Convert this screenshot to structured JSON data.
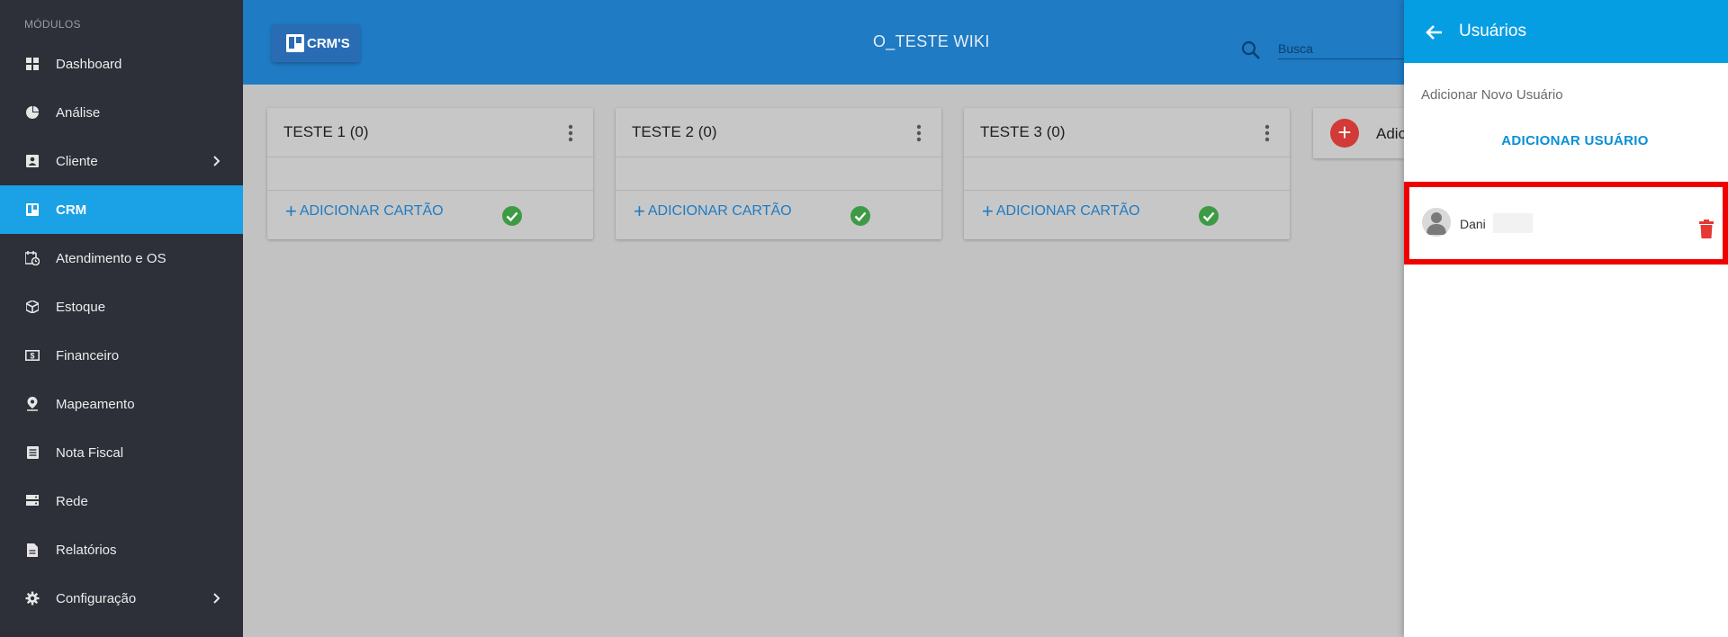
{
  "sidebar": {
    "header": "MÓDULOS",
    "items": [
      {
        "label": "Dashboard",
        "icon": "dashboard-icon"
      },
      {
        "label": "Análise",
        "icon": "pie-chart-icon"
      },
      {
        "label": "Cliente",
        "icon": "contact-icon",
        "expandable": true
      },
      {
        "label": "CRM",
        "icon": "trello-icon",
        "active": true
      },
      {
        "label": "Atendimento e OS",
        "icon": "calendar-clock-icon"
      },
      {
        "label": "Estoque",
        "icon": "box-icon"
      },
      {
        "label": "Financeiro",
        "icon": "money-icon"
      },
      {
        "label": "Mapeamento",
        "icon": "map-pin-icon"
      },
      {
        "label": "Nota Fiscal",
        "icon": "receipt-icon"
      },
      {
        "label": "Rede",
        "icon": "server-icon"
      },
      {
        "label": "Relatórios",
        "icon": "document-icon"
      },
      {
        "label": "Configuração",
        "icon": "gear-icon",
        "expandable": true
      }
    ]
  },
  "topbar": {
    "crms_label": "CRM'S",
    "board_title": "O_TESTE WIKI",
    "search_placeholder": "Busca"
  },
  "board": {
    "columns": [
      {
        "title": "TESTE 1",
        "count": "(0)",
        "add_label": "ADICIONAR CARTÃO"
      },
      {
        "title": "TESTE 2",
        "count": "(0)",
        "add_label": "ADICIONAR CARTÃO"
      },
      {
        "title": "TESTE 3",
        "count": "(0)",
        "add_label": "ADICIONAR CARTÃO"
      }
    ],
    "add_column_label": "Adic"
  },
  "panel": {
    "title": "Usuários",
    "add_new_label": "Adicionar Novo Usuário",
    "add_user_button": "ADICIONAR USUÁRIO",
    "users": [
      {
        "name": "Dani"
      }
    ]
  },
  "colors": {
    "sidebar_bg": "#2d2f39",
    "active_item": "#1ba1e6",
    "topbar_bg": "#1f7bc3",
    "panel_header": "#069ee3",
    "check_green": "#3e9b45",
    "fab_red": "#d13a36",
    "highlight_red": "#f10000"
  }
}
